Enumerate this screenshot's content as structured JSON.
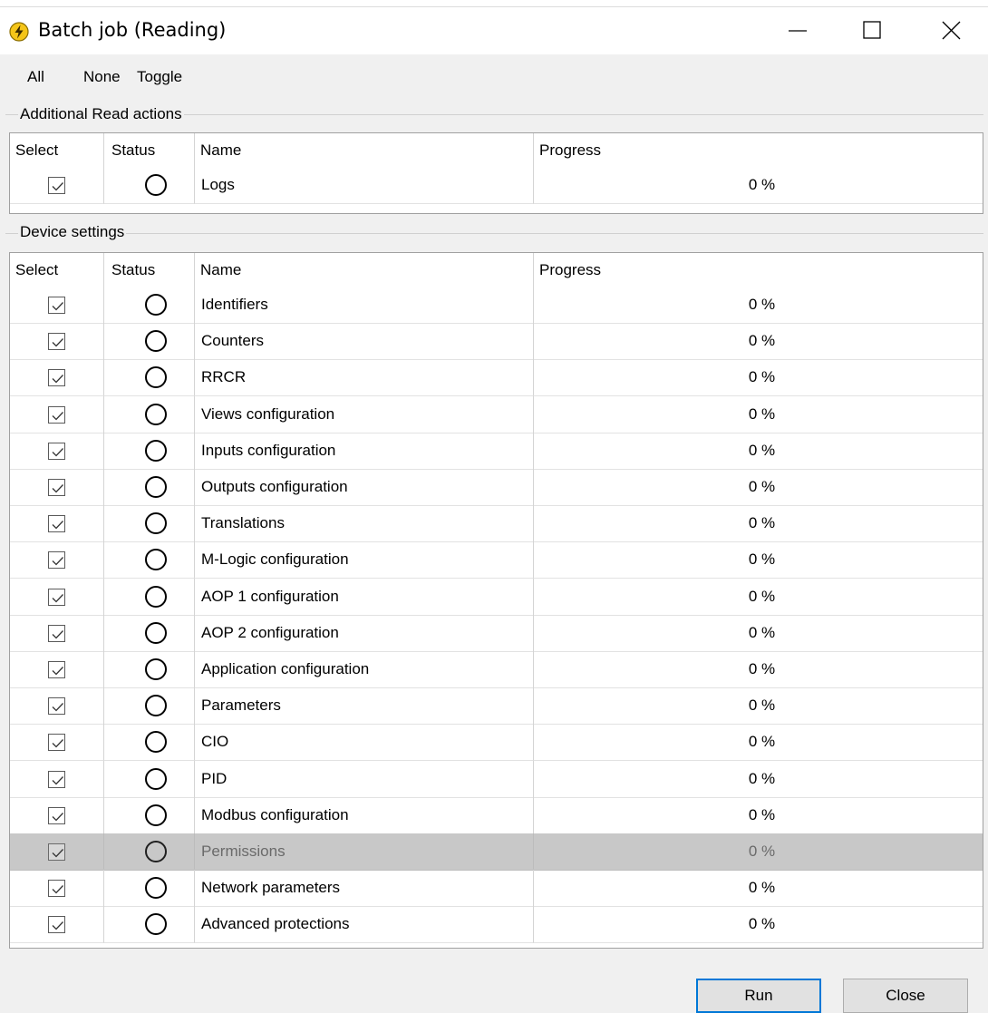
{
  "window": {
    "title": "Batch job (Reading)",
    "icon": "lightning-icon",
    "controls": [
      "minimize-icon",
      "maximize-icon",
      "close-icon"
    ]
  },
  "menu": {
    "all": "All",
    "none": "None",
    "toggle": "Toggle"
  },
  "additional": {
    "legend": "Additional Read actions",
    "headers": {
      "select": "Select",
      "status": "Status",
      "name": "Name",
      "progress": "Progress"
    },
    "rows": [
      {
        "name": "Logs",
        "progress": "0 %",
        "checked": true
      }
    ]
  },
  "device": {
    "legend": "Device settings",
    "headers": {
      "select": "Select",
      "status": "Status",
      "name": "Name",
      "progress": "Progress"
    },
    "rows": [
      {
        "name": "Identifiers",
        "progress": "0 %",
        "checked": true
      },
      {
        "name": "Counters",
        "progress": "0 %",
        "checked": true
      },
      {
        "name": "RRCR",
        "progress": "0 %",
        "checked": true
      },
      {
        "name": "Views configuration",
        "progress": "0 %",
        "checked": true
      },
      {
        "name": "Inputs configuration",
        "progress": "0 %",
        "checked": true
      },
      {
        "name": "Outputs configuration",
        "progress": "0 %",
        "checked": true
      },
      {
        "name": "Translations",
        "progress": "0 %",
        "checked": true
      },
      {
        "name": "M-Logic configuration",
        "progress": "0 %",
        "checked": true
      },
      {
        "name": "AOP 1 configuration",
        "progress": "0 %",
        "checked": true
      },
      {
        "name": "AOP 2 configuration",
        "progress": "0 %",
        "checked": true
      },
      {
        "name": "Application configuration",
        "progress": "0 %",
        "checked": true
      },
      {
        "name": "Parameters",
        "progress": "0 %",
        "checked": true
      },
      {
        "name": "CIO",
        "progress": "0 %",
        "checked": true
      },
      {
        "name": "PID",
        "progress": "0 %",
        "checked": true
      },
      {
        "name": "Modbus configuration",
        "progress": "0 %",
        "checked": true
      },
      {
        "name": "Permissions",
        "progress": "0 %",
        "checked": true,
        "disabled": true
      },
      {
        "name": "Network parameters",
        "progress": "0 %",
        "checked": true
      },
      {
        "name": "Advanced protections",
        "progress": "0 %",
        "checked": true
      }
    ]
  },
  "buttons": {
    "run": "Run",
    "close": "Close"
  },
  "colors": {
    "window_bg": "#f0f0f0",
    "disabled_row": "#c8c8c8",
    "focus_border": "#0078d7",
    "icon_yellow": "#f5c518"
  }
}
